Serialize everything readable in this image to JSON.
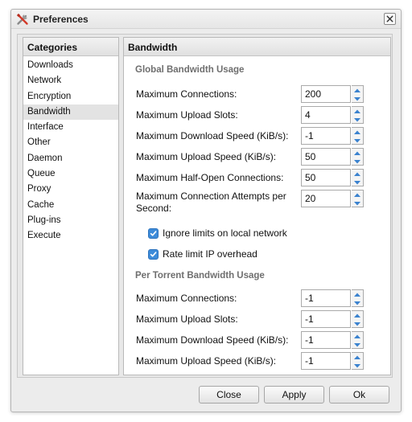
{
  "window": {
    "title": "Preferences",
    "title_icon": "preferences-icon",
    "close_icon": "close-icon"
  },
  "categories": {
    "header": "Categories",
    "selected": "Bandwidth",
    "items": [
      "Downloads",
      "Network",
      "Encryption",
      "Bandwidth",
      "Interface",
      "Other",
      "Daemon",
      "Queue",
      "Proxy",
      "Cache",
      "Plug-ins",
      "Execute"
    ]
  },
  "content": {
    "header": "Bandwidth",
    "global": {
      "heading": "Global Bandwidth Usage",
      "max_connections": {
        "label": "Maximum Connections:",
        "value": "200"
      },
      "max_upload_slots": {
        "label": "Maximum Upload Slots:",
        "value": "4"
      },
      "max_download_speed": {
        "label": "Maximum Download Speed (KiB/s):",
        "value": "-1"
      },
      "max_upload_speed": {
        "label": "Maximum Upload Speed (KiB/s):",
        "value": "50"
      },
      "max_half_open": {
        "label": "Maximum Half-Open Connections:",
        "value": "50"
      },
      "max_conn_attempts": {
        "label": "Maximum Connection Attempts per Second:",
        "value": "20"
      },
      "ignore_local": {
        "label": "Ignore limits on local network",
        "checked": true
      },
      "rate_limit_ip": {
        "label": "Rate limit IP overhead",
        "checked": true
      }
    },
    "per_torrent": {
      "heading": "Per Torrent Bandwidth Usage",
      "max_connections": {
        "label": "Maximum Connections:",
        "value": "-1"
      },
      "max_upload_slots": {
        "label": "Maximum Upload Slots:",
        "value": "-1"
      },
      "max_download_speed": {
        "label": "Maximum Download Speed (KiB/s):",
        "value": "-1"
      },
      "max_upload_speed": {
        "label": "Maximum Upload Speed (KiB/s):",
        "value": "-1"
      }
    }
  },
  "buttons": {
    "close": "Close",
    "apply": "Apply",
    "ok": "Ok"
  },
  "colors": {
    "checkbox_accent": "#3d8bd9",
    "section_heading": "#6e6e6e",
    "selected_category_bg": "#e3e3e3"
  }
}
